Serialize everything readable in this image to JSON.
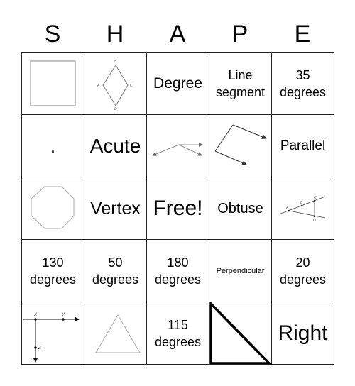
{
  "header": {
    "letters": [
      "S",
      "H",
      "A",
      "P",
      "E"
    ]
  },
  "cells": [
    {
      "type": "image",
      "icon": "square-icon"
    },
    {
      "type": "image",
      "icon": "rhombus-abcd-icon",
      "labels": [
        "B",
        "A",
        "C",
        "D"
      ]
    },
    {
      "type": "text",
      "text": "Degree"
    },
    {
      "type": "text",
      "text": "Line segment",
      "lines": [
        "Line",
        "segment"
      ]
    },
    {
      "type": "text",
      "text": "35 degrees",
      "lines": [
        "35",
        "degrees"
      ]
    },
    {
      "type": "text",
      "text": "."
    },
    {
      "type": "text",
      "text": "Acute"
    },
    {
      "type": "image",
      "icon": "obtuse-rays-icon"
    },
    {
      "type": "image",
      "icon": "acute-angle-rays-icon"
    },
    {
      "type": "text",
      "text": "Parallel"
    },
    {
      "type": "image",
      "icon": "octagon-icon"
    },
    {
      "type": "text",
      "text": "Vertex"
    },
    {
      "type": "text",
      "text": "Free!",
      "free": true
    },
    {
      "type": "text",
      "text": "Obtuse"
    },
    {
      "type": "image",
      "icon": "triangle-rays-abcd-icon",
      "labels": [
        "A",
        "B",
        "C",
        "D"
      ]
    },
    {
      "type": "text",
      "text": "130 degrees",
      "lines": [
        "130",
        "degrees"
      ]
    },
    {
      "type": "text",
      "text": "50 degrees",
      "lines": [
        "50",
        "degrees"
      ]
    },
    {
      "type": "text",
      "text": "180 degrees",
      "lines": [
        "180",
        "degrees"
      ]
    },
    {
      "type": "text",
      "text": "Perpendicular"
    },
    {
      "type": "text",
      "text": "20 degrees",
      "lines": [
        "20",
        "degrees"
      ]
    },
    {
      "type": "image",
      "icon": "perpendicular-rays-xyz-icon",
      "labels": [
        "X",
        "Y",
        "Z"
      ]
    },
    {
      "type": "image",
      "icon": "equilateral-triangle-icon"
    },
    {
      "type": "text",
      "text": "115 degrees",
      "lines": [
        "115",
        "degrees"
      ]
    },
    {
      "type": "image",
      "icon": "right-triangle-icon"
    },
    {
      "type": "text",
      "text": "Right"
    }
  ]
}
